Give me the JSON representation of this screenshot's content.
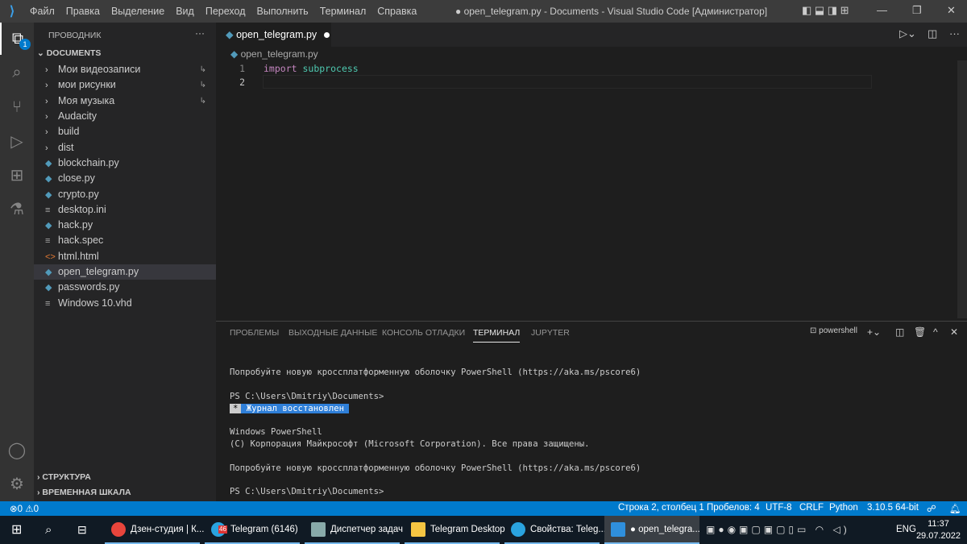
{
  "titlebar": {
    "menu": [
      "Файл",
      "Правка",
      "Выделение",
      "Вид",
      "Переход",
      "Выполнить",
      "Терминал",
      "Справка"
    ],
    "title": "● open_telegram.py - Documents - Visual Studio Code [Администратор]"
  },
  "activity": {
    "explorer_badge": "1"
  },
  "sidebar": {
    "header": "ПРОВОДНИК",
    "more": "···",
    "folder": "DOCUMENTS",
    "items": [
      {
        "label": "Мои видеозаписи",
        "type": "folder",
        "symlink": "↳"
      },
      {
        "label": "мои рисунки",
        "type": "folder",
        "symlink": "↳"
      },
      {
        "label": "Моя музыка",
        "type": "folder",
        "symlink": "↳"
      },
      {
        "label": "Audacity",
        "type": "folder"
      },
      {
        "label": "build",
        "type": "folder"
      },
      {
        "label": "dist",
        "type": "folder"
      },
      {
        "label": "blockchain.py",
        "type": "python"
      },
      {
        "label": "close.py",
        "type": "python"
      },
      {
        "label": "crypto.py",
        "type": "python"
      },
      {
        "label": "desktop.ini",
        "type": "ini"
      },
      {
        "label": "hack.py",
        "type": "python"
      },
      {
        "label": "hack.spec",
        "type": "ini"
      },
      {
        "label": "html.html",
        "type": "html"
      },
      {
        "label": "open_telegram.py",
        "type": "python",
        "selected": true
      },
      {
        "label": "passwords.py",
        "type": "python"
      },
      {
        "label": "Windows 10.vhd",
        "type": "ini"
      }
    ],
    "outline": "СТРУКТУРА",
    "timeline": "ВРЕМЕННАЯ ШКАЛА"
  },
  "editor": {
    "tab": "open_telegram.py",
    "breadcrumb": "open_telegram.py",
    "lines": [
      {
        "n": "1",
        "kw": "import",
        "mod": "subprocess"
      },
      {
        "n": "2"
      }
    ]
  },
  "panel": {
    "tabs": [
      "ПРОБЛЕМЫ",
      "ВЫХОДНЫЕ ДАННЫЕ",
      "КОНСОЛЬ ОТЛАДКИ",
      "ТЕРМИНАЛ",
      "JUPYTER"
    ],
    "active_tab": "ТЕРМИНАЛ",
    "shell": "powershell",
    "terminal": [
      "Попробуйте новую кроссплатформенную оболочку PowerShell (https://aka.ms/pscore6)",
      "PS C:\\Users\\Dmitriy\\Documents>",
      "*",
      "Журнал восстановлен",
      "Windows PowerShell",
      "(C) Корпорация Майкрософт (Microsoft Corporation). Все права защищены.",
      "Попробуйте новую кроссплатформенную оболочку PowerShell (https://aka.ms/pscore6)",
      "PS C:\\Users\\Dmitriy\\Documents>"
    ]
  },
  "statusbar": {
    "errors": "0",
    "warnings": "0",
    "position": "Строка 2, столбец 1",
    "spaces": "Пробелов: 4",
    "encoding": "UTF-8",
    "eol": "CRLF",
    "language": "Python",
    "interpreter": "3.10.5 64-bit"
  },
  "taskbar": {
    "apps": [
      {
        "label": "Дзен-студия | К...",
        "color": "#e8453c"
      },
      {
        "label": "Telegram (6146)",
        "color": "#2aa3df",
        "badge": "46"
      },
      {
        "label": "Диспетчер задач",
        "color": "#8aa"
      },
      {
        "label": "Telegram Desktop",
        "color": "#f5c542"
      },
      {
        "label": "Свойства: Teleg...",
        "color": "#2aa3df"
      },
      {
        "label": "● open_telegra...",
        "color": "#2f8fdc"
      }
    ],
    "lang": "ENG",
    "time": "11:37",
    "date": "29.07.2022"
  },
  "colors": {
    "accent": "#007acc"
  }
}
